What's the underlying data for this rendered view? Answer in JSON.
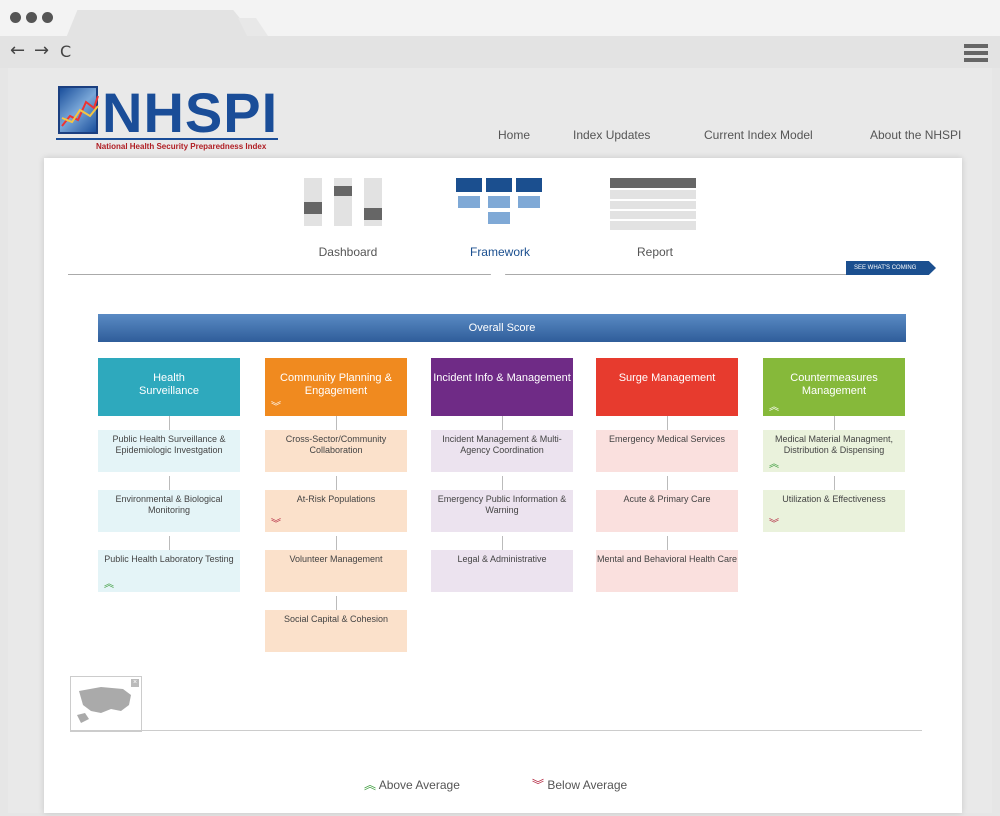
{
  "browser": {
    "back_label": "←",
    "forward_label": "→",
    "reload_label": "C"
  },
  "logo": {
    "title": "NHSPI",
    "subtitle": "National Health Security Preparedness Index"
  },
  "topnav": {
    "items": [
      "Home",
      "Index Updates",
      "Current Index Model",
      "About the NHSPI"
    ]
  },
  "views": {
    "tabs": [
      "Dashboard",
      "Framework",
      "Report"
    ],
    "active": "Framework",
    "see_coming": "SEE WHAT'S COMING"
  },
  "overall_label": "Overall Score",
  "columns": [
    {
      "title": "Health\nSurveillance",
      "color": "#2ea9bd",
      "sub_color": "#e4f4f7",
      "trend": "none",
      "items": [
        {
          "label": "Public Health Surveillance & Epidemiologic Investgation",
          "trend": "none"
        },
        {
          "label": "Environmental & Biological Monitoring",
          "trend": "none"
        },
        {
          "label": "Public Health Laboratory Testing",
          "trend": "up"
        }
      ]
    },
    {
      "title": "Community Planning & Engagement",
      "color": "#f08a1f",
      "sub_color": "#fbe1cb",
      "trend": "down",
      "items": [
        {
          "label": "Cross-Sector/Community Collaboration",
          "trend": "none"
        },
        {
          "label": "At-Risk Populations",
          "trend": "down"
        },
        {
          "label": "Volunteer Management",
          "trend": "none"
        },
        {
          "label": "Social Capital & Cohesion",
          "trend": "none"
        }
      ]
    },
    {
      "title": "Incident Info & Management",
      "color": "#6f2b86",
      "sub_color": "#ece3ef",
      "trend": "none",
      "items": [
        {
          "label": "Incident Management & Multi-Agency Coordination",
          "trend": "none"
        },
        {
          "label": "Emergency Public Information & Warning",
          "trend": "none"
        },
        {
          "label": "Legal & Administrative",
          "trend": "none"
        }
      ]
    },
    {
      "title": "Surge Management",
      "color": "#e73b2e",
      "sub_color": "#fae0de",
      "trend": "none",
      "items": [
        {
          "label": "Emergency Medical Services",
          "trend": "none"
        },
        {
          "label": "Acute & Primary Care",
          "trend": "none"
        },
        {
          "label": "Mental and Behavioral Health Care",
          "trend": "none"
        }
      ]
    },
    {
      "title": "Countermeasures Management",
      "color": "#86b93a",
      "sub_color": "#eaf2dc",
      "trend": "up",
      "items": [
        {
          "label": "Medical Material Managment, Distribution & Dispensing",
          "trend": "up"
        },
        {
          "label": "Utilization & Effectiveness",
          "trend": "down"
        }
      ]
    }
  ],
  "legend": {
    "above": "Above Average",
    "below": "Below Average"
  },
  "icons": {
    "up": "double-chevron-up-icon",
    "down": "double-chevron-down-icon",
    "map": "us-map-icon"
  }
}
